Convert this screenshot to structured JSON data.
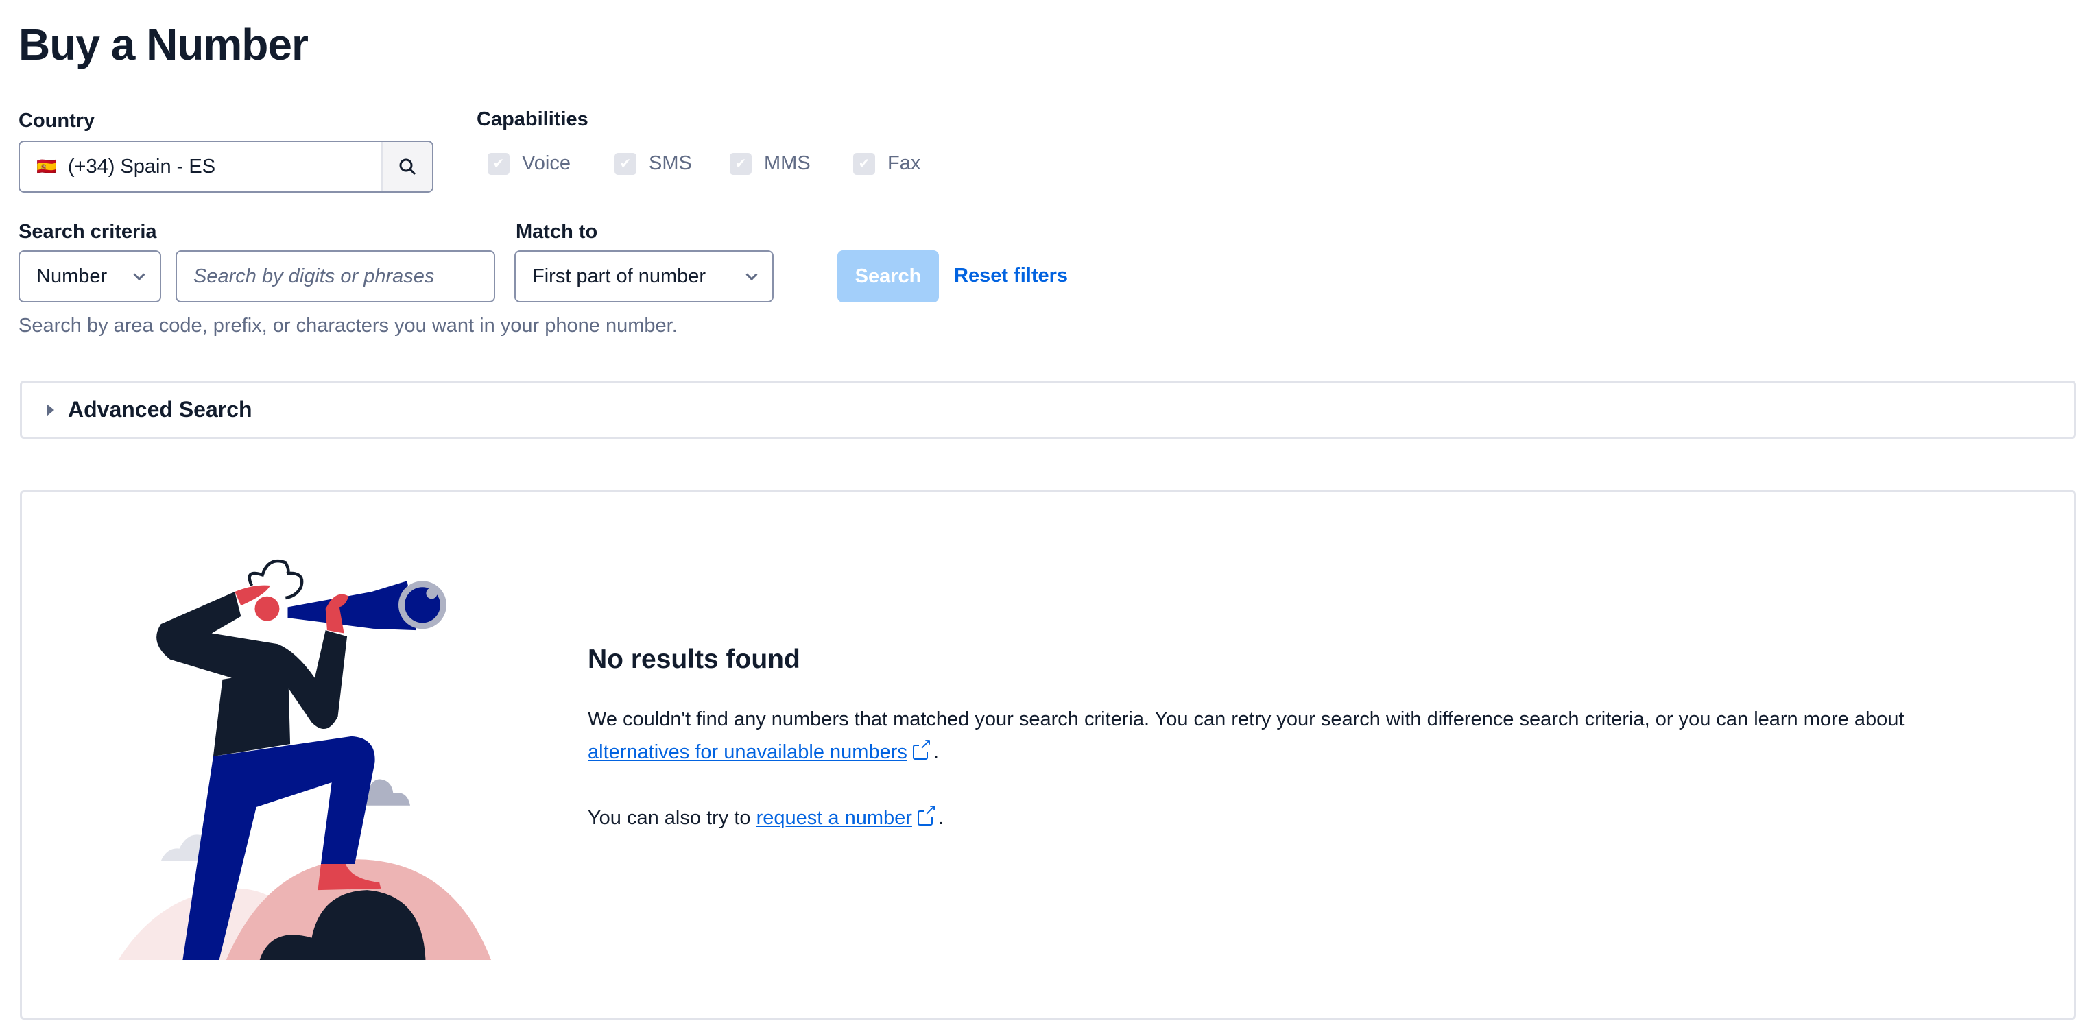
{
  "page": {
    "title": "Buy a Number"
  },
  "country": {
    "label": "Country",
    "value": "(+34) Spain - ES",
    "flag": "🇪🇸",
    "search_icon": "search-icon"
  },
  "capabilities": {
    "label": "Capabilities",
    "items": [
      {
        "label": "Voice",
        "checked": true,
        "disabled": true
      },
      {
        "label": "SMS",
        "checked": true,
        "disabled": true
      },
      {
        "label": "MMS",
        "checked": true,
        "disabled": true
      },
      {
        "label": "Fax",
        "checked": true,
        "disabled": true
      }
    ]
  },
  "search_criteria": {
    "label": "Search criteria",
    "type_value": "Number",
    "placeholder": "Search by digits or phrases",
    "help": "Search by area code, prefix, or characters you want in your phone number."
  },
  "match_to": {
    "label": "Match to",
    "value": "First part of number"
  },
  "actions": {
    "search": "Search",
    "reset": "Reset filters"
  },
  "advanced": {
    "label": "Advanced Search"
  },
  "results": {
    "heading": "No results found",
    "text1": "We couldn't find any numbers that matched your search criteria. You can retry your search with difference search criteria, or you can learn more about",
    "link1": "alternatives for unavailable numbers",
    "period1": ".",
    "text2": "You can also try to",
    "link2": "request a number",
    "period2": "."
  },
  "colors": {
    "primary_disabled": "#a3cffa",
    "link": "#0263e0",
    "text": "#121c2d",
    "border": "#8891aa"
  }
}
